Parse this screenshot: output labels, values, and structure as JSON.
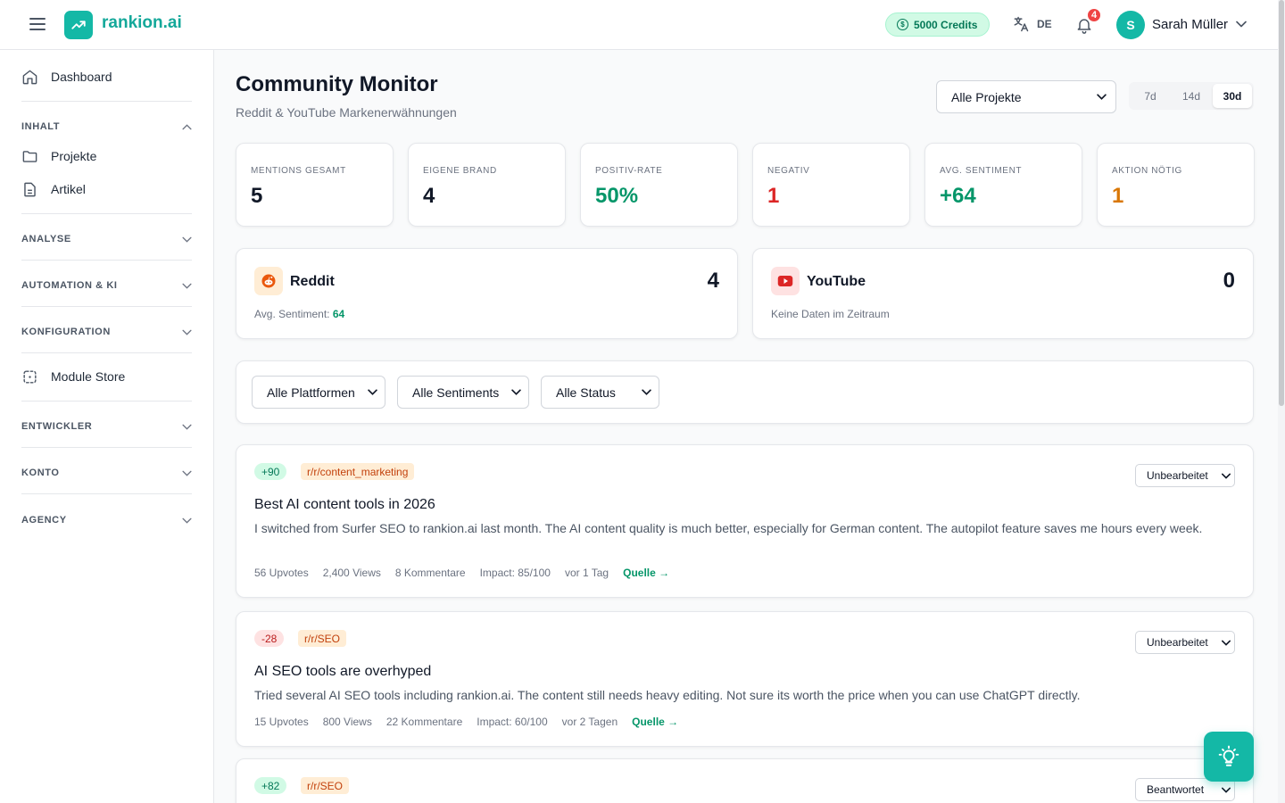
{
  "header": {
    "brand": "rankion.ai",
    "credits": "5000 Credits",
    "language": "DE",
    "notifications": "4",
    "user_initial": "S",
    "user_name": "Sarah Müller"
  },
  "sidebar": {
    "dashboard": "Dashboard",
    "sections": {
      "inhalt": "INHALT",
      "analyse": "ANALYSE",
      "automation": "AUTOMATION & KI",
      "konfiguration": "KONFIGURATION",
      "entwickler": "ENTWICKLER",
      "konto": "KONTO",
      "agency": "AGENCY"
    },
    "projekte": "Projekte",
    "artikel": "Artikel",
    "module_store": "Module Store"
  },
  "page": {
    "title": "Community Monitor",
    "subtitle": "Reddit & YouTube Markenerwähnungen",
    "project_select": "Alle Projekte",
    "ranges": [
      "7d",
      "14d",
      "30d"
    ],
    "active_range": "30d"
  },
  "stats": [
    {
      "label": "MENTIONS GESAMT",
      "value": "5",
      "color": "#111827"
    },
    {
      "label": "EIGENE BRAND",
      "value": "4",
      "color": "#111827"
    },
    {
      "label": "POSITIV-RATE",
      "value": "50%",
      "color": "#059669"
    },
    {
      "label": "NEGATIV",
      "value": "1",
      "color": "#dc2626"
    },
    {
      "label": "AVG. SENTIMENT",
      "value": "+64",
      "color": "#059669"
    },
    {
      "label": "AKTION NÖTIG",
      "value": "1",
      "color": "#d97706"
    }
  ],
  "platforms": {
    "reddit": {
      "name": "Reddit",
      "count": "4",
      "sentiment_label": "Avg. Sentiment:",
      "sentiment_value": "64"
    },
    "youtube": {
      "name": "YouTube",
      "count": "0",
      "note": "Keine Daten im Zeitraum"
    }
  },
  "filters": {
    "platform": "Alle Plattformen",
    "sentiment": "Alle Sentiments",
    "status": "Alle Status"
  },
  "mentions": [
    {
      "score": "+90",
      "subreddit": "r/r/content_marketing",
      "status": "Unbearbeitet",
      "title": "Best AI content tools in 2026",
      "text": "I switched from Surfer SEO to rankion.ai last month. The AI content quality is much better, especially for German content. The autopilot feature saves me hours every week.",
      "upvotes": "56 Upvotes",
      "views": "2,400 Views",
      "comments": "8 Kommentare",
      "impact": "Impact: 85/100",
      "time": "vor 1 Tag",
      "source": "Quelle →"
    },
    {
      "score": "-28",
      "subreddit": "r/r/SEO",
      "status": "Unbearbeitet",
      "title": "AI SEO tools are overhyped",
      "text": "Tried several AI SEO tools including rankion.ai. The content still needs heavy editing. Not sure its worth the price when you can use ChatGPT directly.",
      "upvotes": "15 Upvotes",
      "views": "800 Views",
      "comments": "22 Kommentare",
      "impact": "Impact: 60/100",
      "time": "vor 2 Tagen",
      "source": "Quelle →"
    },
    {
      "score": "+82",
      "subreddit": "r/r/SEO",
      "status": "Beantwortet"
    }
  ],
  "colors": {
    "accent": "#14b8a6",
    "positive": "#059669",
    "negative": "#dc2626",
    "warning": "#d97706"
  }
}
